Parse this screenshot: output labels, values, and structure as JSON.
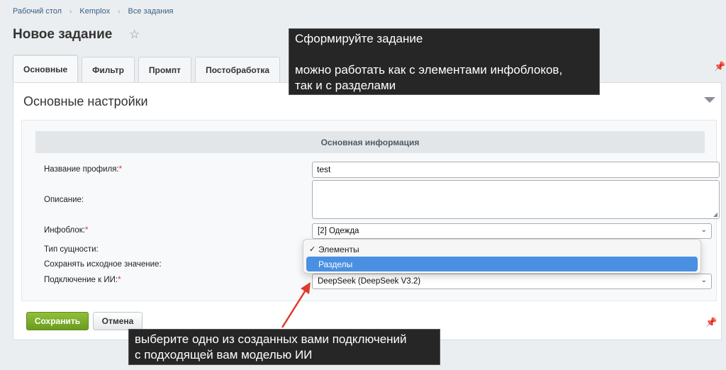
{
  "breadcrumb": [
    "Рабочий стол",
    "Kemplox",
    "Все задания"
  ],
  "page_title": "Новое задание",
  "tabs": [
    {
      "label": "Основные",
      "active": true
    },
    {
      "label": "Фильтр",
      "active": false
    },
    {
      "label": "Промпт",
      "active": false
    },
    {
      "label": "Постобработка",
      "active": false
    }
  ],
  "section_title": "Основные настройки",
  "form": {
    "header": "Основная информация",
    "profile_name_label": "Название профиля:",
    "profile_name_value": "test",
    "description_label": "Описание:",
    "description_value": "",
    "infoblock_label": "Инфоблок:",
    "infoblock_value": "[2] Одежда",
    "entity_type_label": "Тип сущности:",
    "keep_original_label": "Сохранять исходное значение:",
    "ai_connection_label": "Подключение к ИИ:",
    "ai_connection_value": "DeepSeek (DeepSeek V3.2)",
    "required_mark": "*"
  },
  "dropdown": {
    "options": [
      "Элементы",
      "Разделы"
    ],
    "checked": "Элементы",
    "highlighted": "Разделы",
    "check_glyph": "✓"
  },
  "buttons": {
    "save": "Сохранить",
    "cancel": "Отмена"
  },
  "tooltips": {
    "top_line1": "Сформируйте задание",
    "top_line2": "можно работать как с элементами инфоблоков,",
    "top_line3": "так и с разделами",
    "bottom_line1": "выберите одно из созданных вами подключений",
    "bottom_line2": "с подходящей вам моделью ИИ"
  },
  "colors": {
    "accent_green": "#7aab2a",
    "highlight_blue": "#4a90e2",
    "tooltip_bg": "#262626",
    "arrow_red": "#e03a2e",
    "required_red": "#d33333"
  },
  "icons": [
    "star-icon",
    "pin-icon",
    "collapse-icon",
    "chevron-down-icon",
    "check-icon",
    "resize-icon"
  ]
}
